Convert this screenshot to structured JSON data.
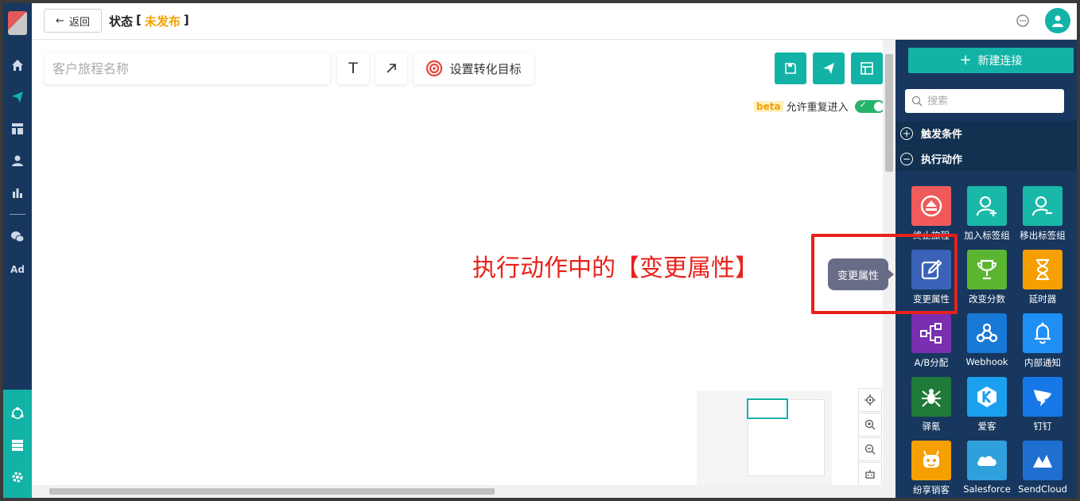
{
  "header": {
    "back_label": "返回",
    "status_prefix": "状态",
    "bracket_open": "[",
    "status_value": "未发布",
    "bracket_close": "]"
  },
  "toolbar": {
    "name_placeholder": "客户旅程名称",
    "text_tool": "T",
    "goal_label": "设置转化目标"
  },
  "options": {
    "beta_tag": "beta",
    "repeat_label": "允许重复进入",
    "repeat_enabled": true
  },
  "annotation": {
    "text": "执行动作中的【变更属性】",
    "tooltip": "变更属性"
  },
  "panel": {
    "new_conn_label": "新建连接",
    "search_placeholder": "搜索",
    "sections": [
      {
        "label": "触发条件",
        "expanded": false,
        "toggle": "+"
      },
      {
        "label": "执行动作",
        "expanded": true,
        "toggle": "−"
      }
    ],
    "tiles": [
      {
        "label": "终止旅程",
        "color": "#f05a5a",
        "icon": "stop-icon"
      },
      {
        "label": "加入标签组",
        "color": "#1ab8a9",
        "icon": "user-add-icon"
      },
      {
        "label": "移出标签组",
        "color": "#1ab8a9",
        "icon": "user-remove-icon"
      },
      {
        "label": "变更属性",
        "color": "#3a63b8",
        "icon": "edit-icon"
      },
      {
        "label": "改变分数",
        "color": "#5cb531",
        "icon": "trophy-icon"
      },
      {
        "label": "延时器",
        "color": "#f59f00",
        "icon": "hourglass-icon"
      },
      {
        "label": "A/B分配",
        "color": "#7a2eb0",
        "icon": "split-icon"
      },
      {
        "label": "Webhook",
        "color": "#1778d6",
        "icon": "webhook-icon"
      },
      {
        "label": "内部通知",
        "color": "#1e90f5",
        "icon": "bell-icon"
      },
      {
        "label": "驿氪",
        "color": "#1f7a3a",
        "icon": "spider-icon"
      },
      {
        "label": "爱客",
        "color": "#1ba0f0",
        "icon": "k-logo-icon"
      },
      {
        "label": "钉钉",
        "color": "#1677e6",
        "icon": "dingtalk-icon"
      },
      {
        "label": "纷享销客",
        "color": "#f5a000",
        "icon": "fxiaoke-icon"
      },
      {
        "label": "Salesforce",
        "color": "#2fa0dc",
        "icon": "cloud-icon"
      },
      {
        "label": "SendCloud",
        "color": "#1f6fd1",
        "icon": "sendcloud-icon"
      }
    ]
  },
  "colors": {
    "accent": "#12b3a6",
    "nav": "#17375e",
    "warning": "#f2a100",
    "annotation": "#e8211b"
  }
}
